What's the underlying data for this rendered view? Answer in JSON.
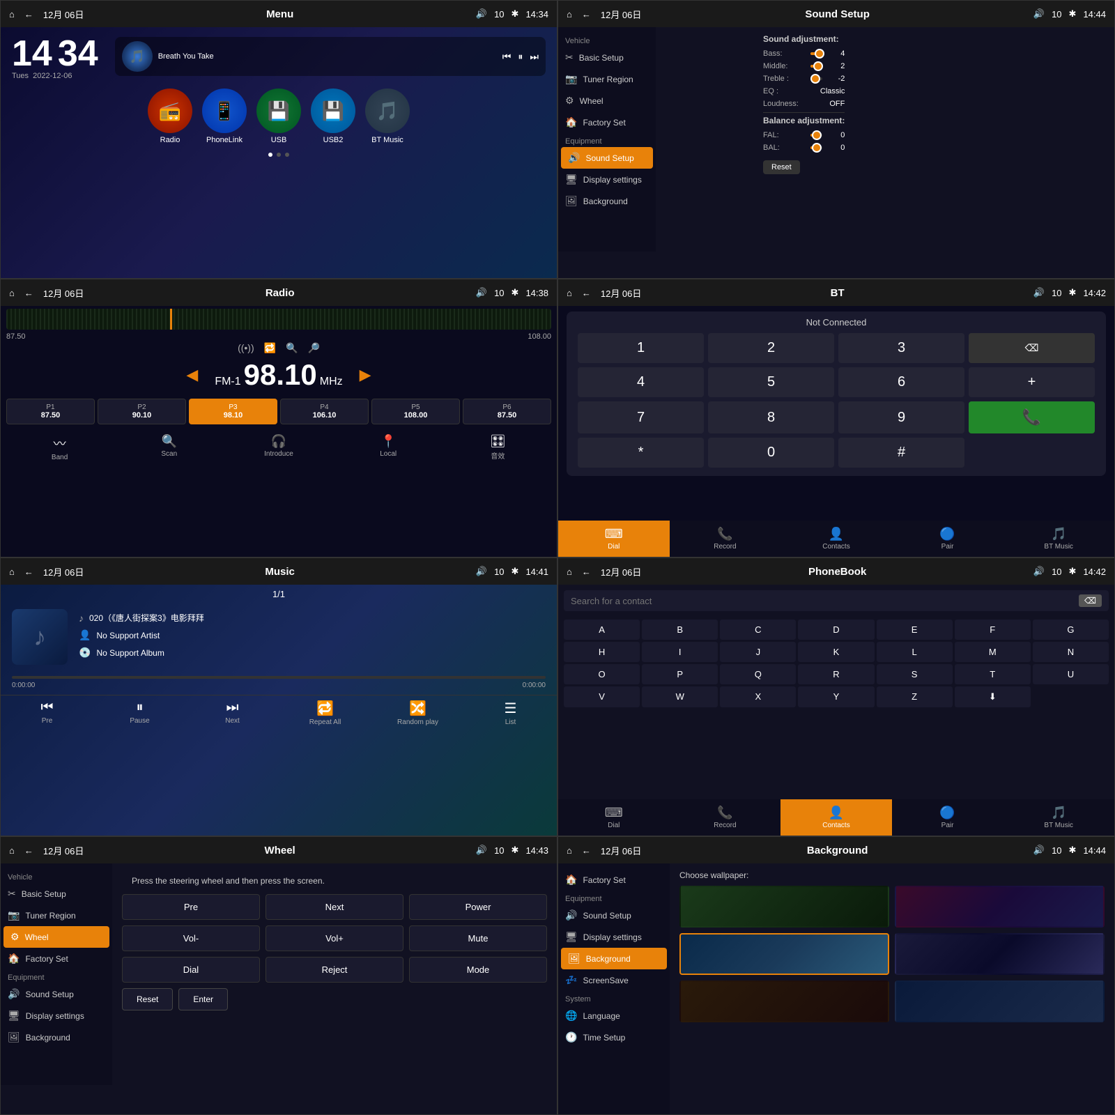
{
  "panels": {
    "home": {
      "topbar": {
        "date": "12月 06日",
        "title": "Menu",
        "vol": "10",
        "time": "14:34"
      },
      "clock": {
        "hour": "14",
        "min": "34",
        "day": "Tues",
        "date": "2022-12-06"
      },
      "music": {
        "title": "Breath You Take"
      },
      "icons": [
        {
          "id": "radio",
          "label": "Radio",
          "icon": "📻",
          "class": "ic-radio"
        },
        {
          "id": "phonelink",
          "label": "PhoneLink",
          "icon": "📱",
          "class": "ic-phonelink"
        },
        {
          "id": "usb",
          "label": "USB",
          "icon": "💾",
          "class": "ic-usb"
        },
        {
          "id": "usb2",
          "label": "USB2",
          "icon": "💾",
          "class": "ic-usb2"
        },
        {
          "id": "btmusic",
          "label": "BT Music",
          "icon": "🎵",
          "class": "ic-btmusic"
        }
      ]
    },
    "sound": {
      "topbar": {
        "date": "12月 06日",
        "title": "Sound Setup",
        "vol": "10",
        "time": "14:44"
      },
      "sidebar": {
        "vehicle": "Vehicle",
        "items_vehicle": [
          {
            "label": "Basic Setup",
            "icon": "✂"
          },
          {
            "label": "Tuner Region",
            "icon": "📷"
          },
          {
            "label": "Wheel",
            "icon": "⚙"
          },
          {
            "label": "Factory Set",
            "icon": "🏠"
          }
        ],
        "equipment": "Equipment",
        "items_equip": [
          {
            "label": "Sound Setup",
            "icon": "🔊",
            "active": true
          },
          {
            "label": "Display settings",
            "icon": "🖥"
          },
          {
            "label": "Background",
            "icon": "🖼"
          }
        ]
      },
      "sound_adj": "Sound adjustment:",
      "bass_label": "Bass:",
      "bass_val": "4",
      "bass_pct": 75,
      "mid_label": "Middle:",
      "mid_val": "2",
      "mid_pct": 65,
      "treble_label": "Treble :",
      "treble_val": "-2",
      "treble_pct": 40,
      "eq_label": "EQ :",
      "eq_val": "Classic",
      "loud_label": "Loudness:",
      "loud_val": "OFF",
      "bal_adj": "Balance adjustment:",
      "fal_label": "FAL:",
      "fal_val": "0",
      "fal_pct": 50,
      "bal_label": "BAL:",
      "bal_val": "0",
      "bal_pct": 50,
      "reset_label": "Reset"
    },
    "radio": {
      "topbar": {
        "date": "12月 06日",
        "title": "Radio",
        "vol": "10",
        "time": "14:38"
      },
      "range_low": "87.50",
      "range_high": "108.00",
      "fm": "FM-1",
      "freq": "98.10",
      "unit": "MHz",
      "presets": [
        {
          "label": "P1",
          "freq": "87.50",
          "active": false
        },
        {
          "label": "P2",
          "freq": "90.10",
          "active": false
        },
        {
          "label": "P3",
          "freq": "98.10",
          "active": true
        },
        {
          "label": "P4",
          "freq": "106.10",
          "active": false
        },
        {
          "label": "P5",
          "freq": "108.00",
          "active": false
        },
        {
          "label": "P6",
          "freq": "87.50",
          "active": false
        }
      ],
      "btns": [
        {
          "label": "Band",
          "icon": "〰"
        },
        {
          "label": "Scan",
          "icon": "🔍"
        },
        {
          "label": "Introduce",
          "icon": "🎧"
        },
        {
          "label": "Local",
          "icon": "📍"
        },
        {
          "label": "音效",
          "icon": "🎛"
        }
      ]
    },
    "bt": {
      "topbar": {
        "date": "12月 06日",
        "title": "BT",
        "vol": "10",
        "time": "14:42"
      },
      "not_connected": "Not Connected",
      "numpad": [
        "1",
        "2",
        "3",
        "⌫",
        "4",
        "5",
        "6",
        "+",
        "7",
        "8",
        "9",
        "📞",
        "*",
        "0",
        "#",
        ""
      ],
      "tabs": [
        {
          "label": "Dial",
          "icon": "⌨",
          "active": true
        },
        {
          "label": "Record",
          "icon": "📞"
        },
        {
          "label": "Contacts",
          "icon": "👤"
        },
        {
          "label": "Pair",
          "icon": "🔵"
        },
        {
          "label": "BT Music",
          "icon": "🎵"
        }
      ]
    },
    "music": {
      "topbar": {
        "date": "12月 06日",
        "title": "Music",
        "vol": "10",
        "time": "14:41"
      },
      "track_pos": "1/1",
      "track_name": "020（《唐人街探案3》电影拜拜",
      "artist": "No Support Artist",
      "album": "No Support Album",
      "time_cur": "0:00:00",
      "time_total": "0:00:00",
      "progress": 0,
      "ctrls": [
        {
          "label": "Pre",
          "icon": "⏮"
        },
        {
          "label": "Pause",
          "icon": "⏸"
        },
        {
          "label": "Next",
          "icon": "⏭"
        },
        {
          "label": "Repeat All",
          "icon": "🔁"
        },
        {
          "label": "Random play",
          "icon": "🔀"
        },
        {
          "label": "List",
          "icon": "☰"
        }
      ]
    },
    "phonebook": {
      "topbar": {
        "date": "12月 06日",
        "title": "PhoneBook",
        "vol": "10",
        "time": "14:42"
      },
      "search_placeholder": "Search for a contact",
      "alpha": [
        "A",
        "B",
        "C",
        "D",
        "E",
        "F",
        "G",
        "H",
        "I",
        "J",
        "K",
        "L",
        "M",
        "N",
        "O",
        "P",
        "Q",
        "R",
        "S",
        "T",
        "U",
        "V",
        "W",
        "X",
        "Y",
        "Z",
        "⬇"
      ],
      "tabs": [
        {
          "label": "Dial",
          "icon": "⌨"
        },
        {
          "label": "Record",
          "icon": "📞"
        },
        {
          "label": "Contacts",
          "icon": "👤",
          "active": true
        },
        {
          "label": "Pair",
          "icon": "🔵"
        },
        {
          "label": "BT Music",
          "icon": "🎵"
        }
      ]
    },
    "wheel": {
      "topbar": {
        "date": "12月 06日",
        "title": "Wheel",
        "vol": "10",
        "time": "14:43"
      },
      "note": "Press the steering wheel and then press the screen.",
      "sidebar": {
        "vehicle": "Vehicle",
        "items": [
          {
            "label": "Basic Setup",
            "icon": "✂"
          },
          {
            "label": "Tuner Region",
            "icon": "📷"
          },
          {
            "label": "Wheel",
            "icon": "⚙",
            "active": true
          },
          {
            "label": "Factory Set",
            "icon": "🏠"
          }
        ],
        "equipment": "Equipment",
        "equip_items": [
          {
            "label": "Sound Setup",
            "icon": "🔊"
          },
          {
            "label": "Display settings",
            "icon": "🖥"
          },
          {
            "label": "Background",
            "icon": "🖼"
          }
        ]
      },
      "btns": [
        [
          "Pre",
          "Next",
          "Power"
        ],
        [
          "Vol-",
          "Vol+",
          "Mute"
        ],
        [
          "Dial",
          "Reject",
          "Mode"
        ]
      ],
      "reset_label": "Reset",
      "enter_label": "Enter"
    },
    "background": {
      "topbar": {
        "date": "12月 06日",
        "title": "Background",
        "vol": "10",
        "time": "14:44"
      },
      "sidebar": {
        "items": [
          {
            "label": "Factory Set",
            "icon": "🏠"
          }
        ],
        "equipment": "Equipment",
        "equip_items": [
          {
            "label": "Sound Setup",
            "icon": "🔊"
          },
          {
            "label": "Display settings",
            "icon": "🖥"
          },
          {
            "label": "Background",
            "icon": "🖼",
            "active": true
          },
          {
            "label": "ScreenSave",
            "icon": "💤"
          }
        ],
        "system": "System",
        "sys_items": [
          {
            "label": "Language",
            "icon": "🌐"
          },
          {
            "label": "Time Setup",
            "icon": "🕐"
          }
        ]
      },
      "choose_label": "Choose wallpaper:",
      "wallpapers": [
        "wp1",
        "wp2",
        "wp3",
        "wp4",
        "wp5",
        "wp6"
      ]
    }
  },
  "icons": {
    "home": "⌂",
    "back": "←",
    "vol": "🔊",
    "bt": "✱"
  }
}
